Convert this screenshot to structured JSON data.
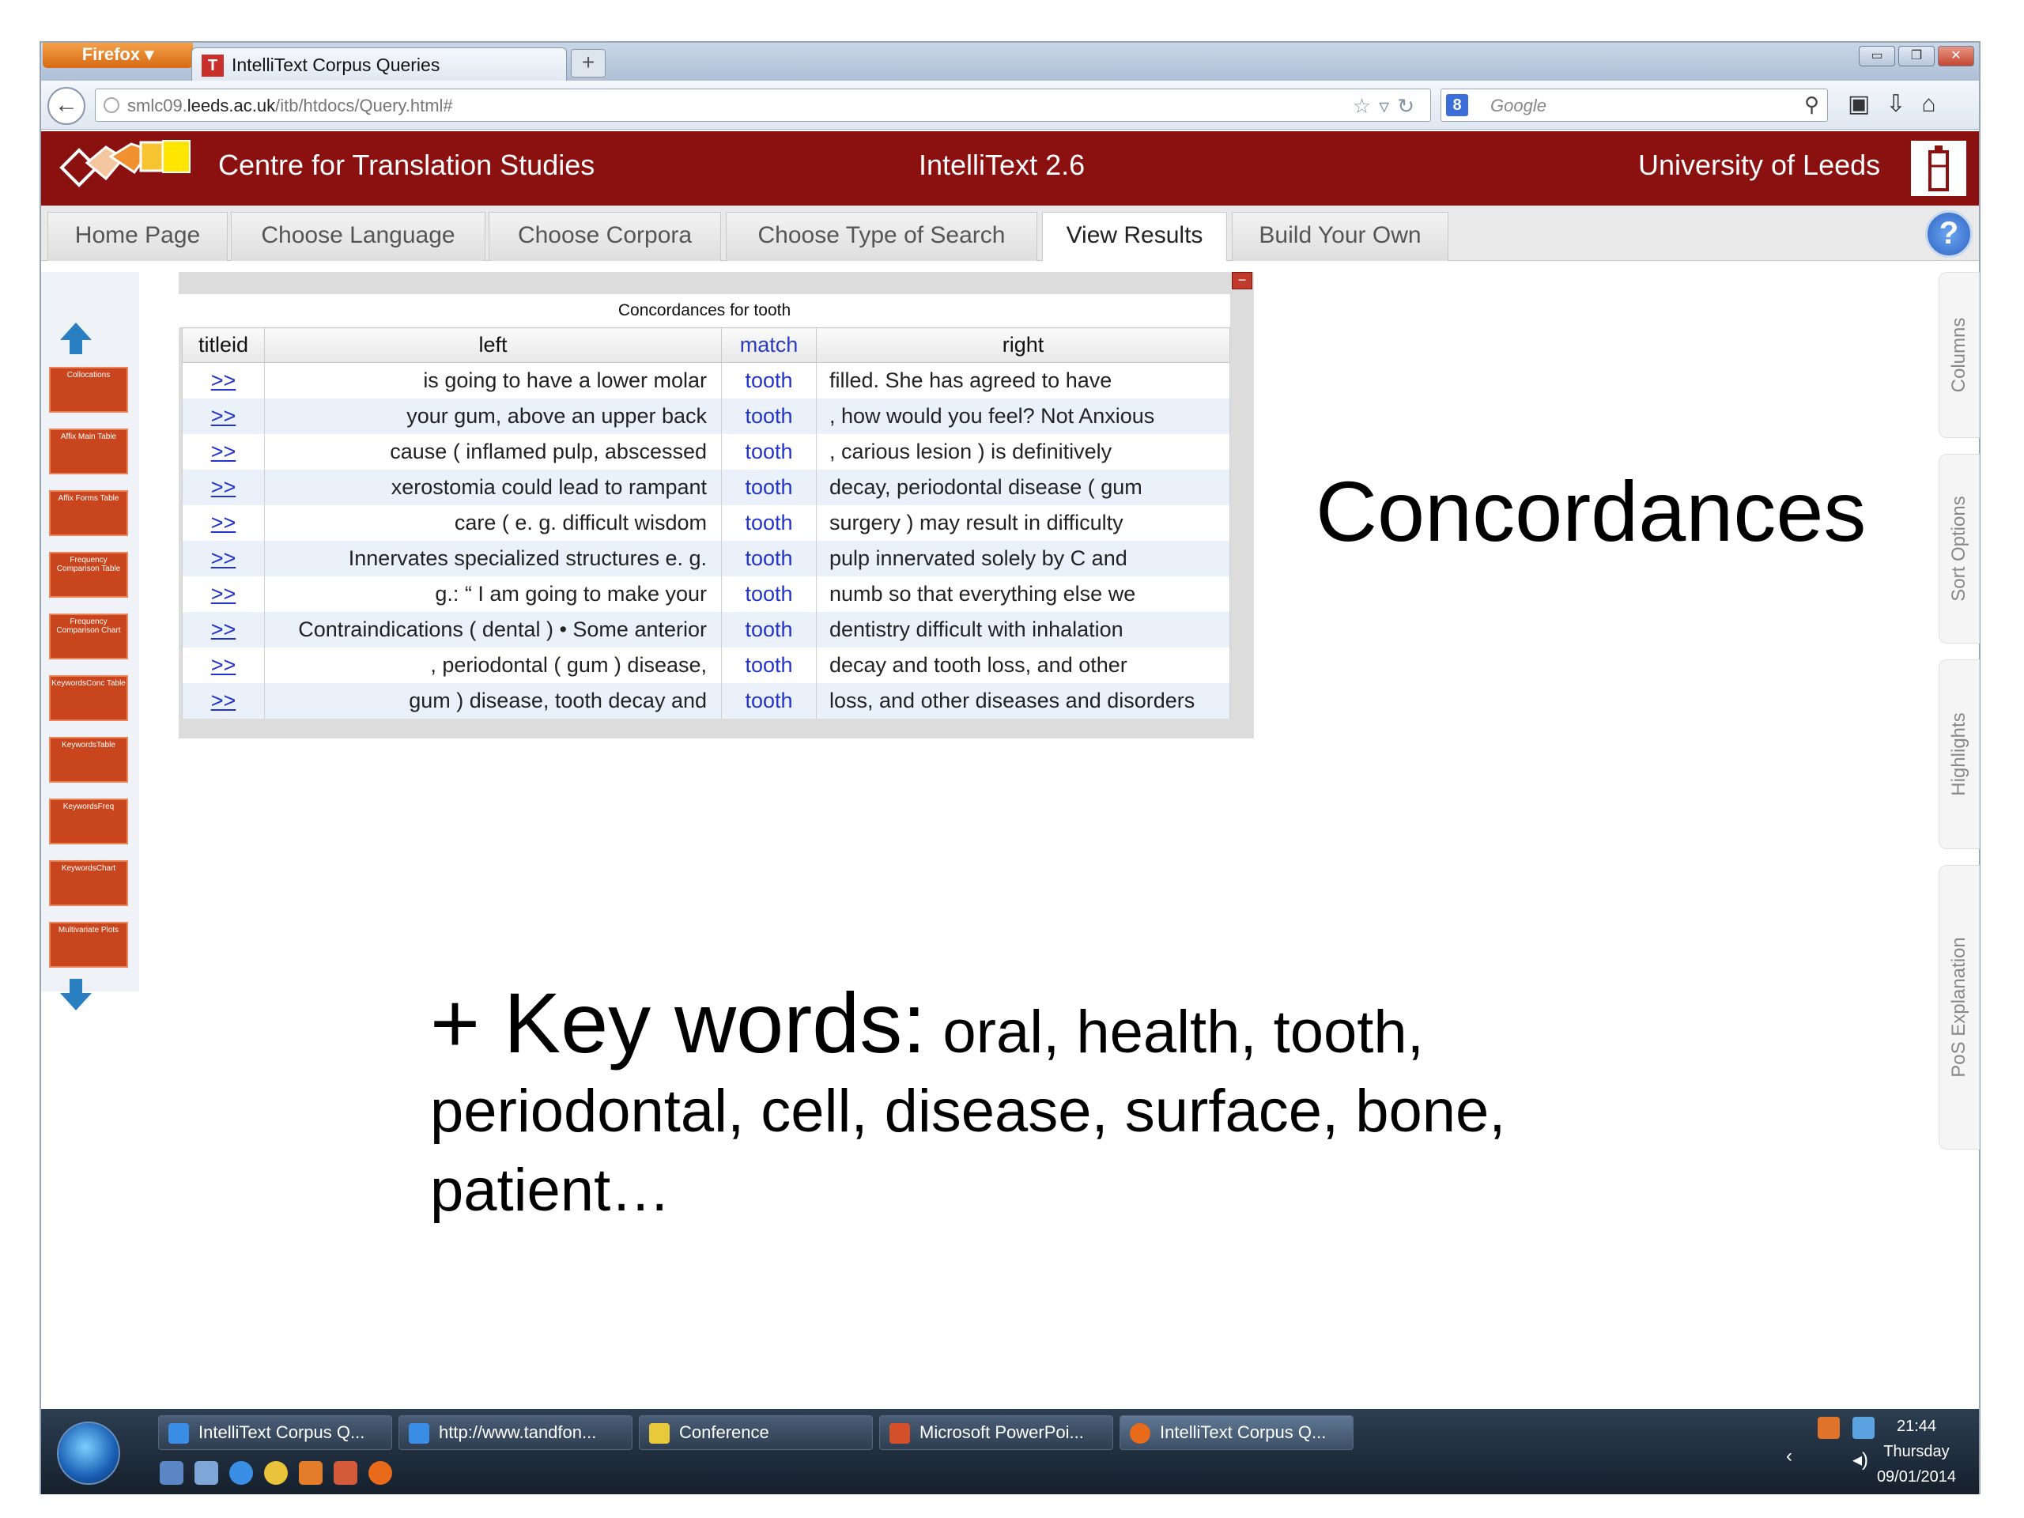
{
  "browser": {
    "menu_label": "Firefox",
    "tab_title": "IntelliText Corpus Queries",
    "newtab_label": "+",
    "url_prefix": "smlc09.",
    "url_domain": "leeds.ac.uk",
    "url_path": "/itb/htdocs/Query.html#",
    "search_placeholder": "Google",
    "search_engine_letter": "8"
  },
  "header": {
    "left": "Centre for Translation Studies",
    "middle": "IntelliText  2.6",
    "right": "University of Leeds"
  },
  "site_tabs": [
    "Home Page",
    "Choose Language",
    "Choose Corpora",
    "Choose Type of Search",
    "View Results",
    "Build Your Own"
  ],
  "active_tab": "View Results",
  "help_label": "?",
  "tool_buttons": [
    "Collocations",
    "Affix Main Table",
    "Affix Forms Table",
    "Frequency Comparison Table",
    "Frequency Comparison Chart",
    "KeywordsConc Table",
    "KeywordsTable",
    "KeywordsFreq",
    "KeywordsChart",
    "Multivariate Plots"
  ],
  "concordance": {
    "caption": "Concordances for tooth",
    "headers": {
      "titleid": "titleid",
      "left": "left",
      "match": "match",
      "right": "right"
    },
    "link_label": ">>",
    "rows": [
      {
        "left": "is going to have a lower molar",
        "match": "tooth",
        "right": "filled. She has agreed to have"
      },
      {
        "left": "your gum, above an upper back",
        "match": "tooth",
        "right": ", how would you feel? Not Anxious"
      },
      {
        "left": "cause ( inflamed pulp, abscessed",
        "match": "tooth",
        "right": ", carious lesion ) is definitively"
      },
      {
        "left": "xerostomia could lead to rampant",
        "match": "tooth",
        "right": "decay, periodontal disease ( gum"
      },
      {
        "left": "care ( e. g. difficult wisdom",
        "match": "tooth",
        "right": "surgery ) may result in difficulty"
      },
      {
        "left": "Innervates specialized structures e. g.",
        "match": "tooth",
        "right": "pulp innervated solely by C and"
      },
      {
        "left": "g.: “ I am going to make your",
        "match": "tooth",
        "right": "numb so that everything else we"
      },
      {
        "left": "Contraindications ( dental ) • Some anterior",
        "match": "tooth",
        "right": "dentistry difficult with inhalation"
      },
      {
        "left": ", periodontal ( gum ) disease,",
        "match": "tooth",
        "right": "decay and tooth loss, and other"
      },
      {
        "left": "gum ) disease, tooth decay and",
        "match": "tooth",
        "right": "loss, and other diseases and disorders"
      }
    ]
  },
  "slide": {
    "title": "Concordances",
    "keywords_head": "+ Key words:",
    "keywords_text": " oral, health, tooth, periodontal, cell, disease, surface, bone, patient…"
  },
  "side_tabs": [
    "Columns",
    "Sort Options",
    "Highlights",
    "PoS Explanation"
  ],
  "taskbar": {
    "tasks": [
      {
        "label": "IntelliText Corpus Q...",
        "color": "#3a8ee6"
      },
      {
        "label": "http://www.tandfon...",
        "color": "#3a8ee6"
      },
      {
        "label": "Conference",
        "color": "#e8c93a"
      },
      {
        "label": "Microsoft PowerPoi...",
        "color": "#d3502a"
      },
      {
        "label": "IntelliText Corpus Q...",
        "color": "#e86a1a"
      }
    ],
    "time": "21:44",
    "day": "Thursday",
    "date": "09/01/2014"
  },
  "colors": {
    "header_red": "#8b1010",
    "link_blue": "#2233cc",
    "tool_orange": "#c8451d"
  }
}
